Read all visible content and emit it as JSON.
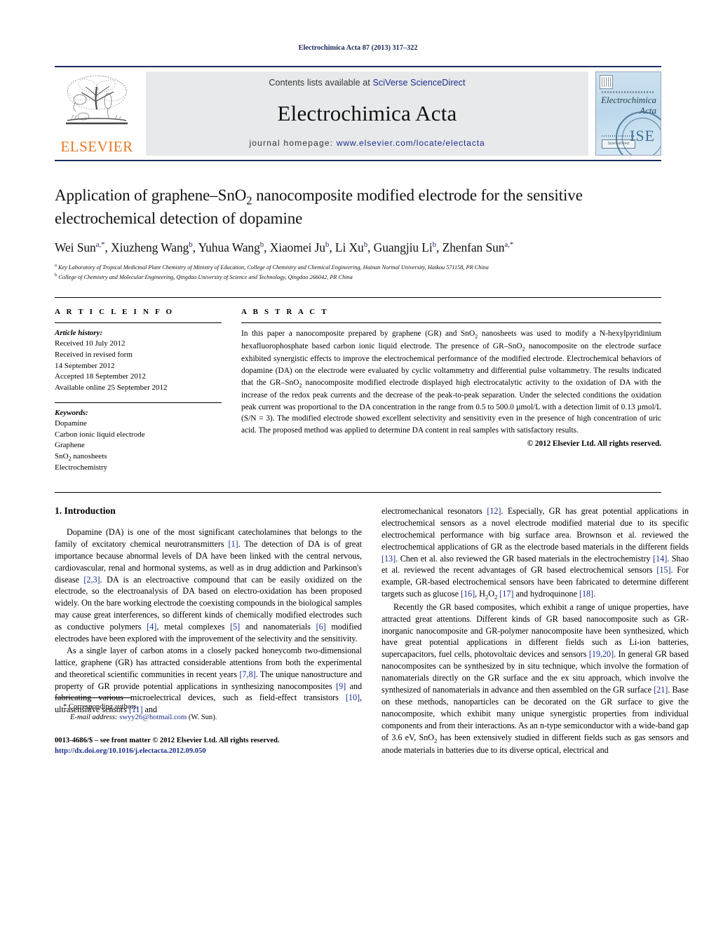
{
  "running_head": "Electrochimica Acta 87 (2013) 317–322",
  "masthead": {
    "publisher_name": "ELSEVIER",
    "contents_prefix": "Contents lists available at ",
    "contents_link": "SciVerse ScienceDirect",
    "journal_title": "Electrochimica Acta",
    "homepage_prefix": "journal homepage: ",
    "homepage_url": "www.elsevier.com/locate/electacta",
    "cover": {
      "line1": "Electrochimica",
      "line2": "Acta",
      "banner": "INTERNATIONAL JOURNAL OF ELECTROCHEMISTRY",
      "badge": "ScienceDirect",
      "seal": "ISE"
    },
    "band_bg": "#e8e9ea",
    "link_color": "#1a2e8c",
    "rule_color": "#1b2a5e",
    "elsevier_orange": "#e87722"
  },
  "article": {
    "title_line1": "Application of graphene–SnO",
    "title_sub1": "2",
    "title_line1b": " nanocomposite modified electrode for the",
    "title_line2": "sensitive electrochemical detection of dopamine",
    "authors_full": "Wei Sun a,*, Xiuzheng Wang b, Yuhua Wang b, Xiaomei Ju b, Li Xu b, Guangjiu Li b, Zhenfan Sun a,*",
    "authors": [
      {
        "name": "Wei Sun",
        "sup": "a,*"
      },
      {
        "name": "Xiuzheng Wang",
        "sup": "b"
      },
      {
        "name": "Yuhua Wang",
        "sup": "b"
      },
      {
        "name": "Xiaomei Ju",
        "sup": "b"
      },
      {
        "name": "Li Xu",
        "sup": "b"
      },
      {
        "name": "Guangjiu Li",
        "sup": "b"
      },
      {
        "name": "Zhenfan Sun",
        "sup": "a,*"
      }
    ],
    "affiliations": [
      {
        "marker": "a",
        "text": "Key Laboratory of Tropical Medicinal Plant Chemistry of Ministry of Education, College of Chemistry and Chemical Engineering, Hainan Normal University, Haikou 571158, PR China"
      },
      {
        "marker": "b",
        "text": "College of Chemistry and Molecular Engineering, Qingdao University of Science and Technology, Qingdao 266042, PR China"
      }
    ]
  },
  "article_info": {
    "heading": "A R T I C L E   I N F O",
    "history_label": "Article history:",
    "history": [
      "Received 10 July 2012",
      "Received in revised form",
      "14 September 2012",
      "Accepted 18 September 2012",
      "Available online 25 September 2012"
    ],
    "keywords_label": "Keywords:",
    "keywords": [
      "Dopamine",
      "Carbon ionic liquid electrode",
      "Graphene",
      "SnO2 nanosheets",
      "Electrochemistry"
    ]
  },
  "abstract": {
    "heading": "A B S T R A C T",
    "paragraph_1": "In this paper a nanocomposite prepared by graphene (GR) and SnO",
    "paragraph_1b": " nanosheets was used to modify a N-hexylpyridinium hexafluorophosphate based carbon ionic liquid electrode. The presence of GR–SnO",
    "paragraph_1c": " nanocomposite on the electrode surface exhibited synergistic effects to improve the electrochemical performance of the modified electrode. Electrochemical behaviors of dopamine (DA) on the electrode were evaluated by cyclic voltammetry and differential pulse voltammetry. The results indicated that the GR–SnO",
    "paragraph_1d": " nanocomposite modified electrode displayed high electrocatalytic activity to the oxidation of DA with the increase of the redox peak currents and the decrease of the peak-to-peak separation. Under the selected conditions the oxidation peak current was proportional to the DA concentration in the range from 0.5 to 500.0 µmol/L with a detection limit of 0.13 µmol/L (S/N = 3). The modified electrode showed excellent selectivity and sensitivity even in the presence of high concentration of uric acid. The proposed method was applied to determine DA content in real samples with satisfactory results.",
    "copyright": "© 2012 Elsevier Ltd. All rights reserved."
  },
  "body": {
    "section_number_title": "1.  Introduction",
    "left_col": {
      "p1_a": "Dopamine (DA) is one of the most significant catecholamines that belongs to the family of excitatory chemical neurotransmitters ",
      "p1_r1": "[1]",
      "p1_b": ". The detection of DA is of great importance because abnormal levels of DA have been linked with the central nervous, cardiovascular, renal and hormonal systems, as well as in drug addiction and Parkinson's disease ",
      "p1_r2": "[2,3]",
      "p1_c": ". DA is an electroactive compound that can be easily oxidized on the electrode, so the electroanalysis of DA based on electro-oxidation has been proposed widely. On the bare working electrode the coexisting compounds in the biological samples may cause great interferences, so different kinds of chemically modified electrodes such as conductive polymers ",
      "p1_r3": "[4]",
      "p1_d": ", metal complexes ",
      "p1_r4": "[5]",
      "p1_e": " and nanomaterials ",
      "p1_r5": "[6]",
      "p1_f": " modified electrodes have been explored with the improvement of the selectivity and the sensitivity.",
      "p2_a": "As a single layer of carbon atoms in a closely packed honeycomb two-dimensional lattice, graphene (GR) has attracted considerable attentions from both the experimental and theoretical scientific communities in recent years ",
      "p2_r1": "[7,8]",
      "p2_b": ". The unique nanostructure and property of GR provide potential applications in synthesizing nanocomposites ",
      "p2_r2": "[9]",
      "p2_c": " and fabricating various microelectrical devices, such as field-effect transistors ",
      "p2_r3": "[10]",
      "p2_d": ", ultrasensitive sensors ",
      "p2_r4": "[11]",
      "p2_e": " and"
    },
    "right_col": {
      "p1_a": "electromechanical resonators ",
      "p1_r1": "[12]",
      "p1_b": ". Especially, GR has great potential applications in electrochemical sensors as a novel electrode modified material due to its specific electrochemical performance with big surface area. Brownson et al. reviewed the electrochemical applications of GR as the electrode based materials in the different fields ",
      "p1_r2": "[13]",
      "p1_c": ". Chen et al. also reviewed the GR based materials in the electrochemistry ",
      "p1_r3": "[14]",
      "p1_d": ". Shao et al. reviewed the recent advantages of GR based electrochemical sensors ",
      "p1_r4": "[15]",
      "p1_e": ". For example, GR-based electrochemical sensors have been fabricated to determine different targets such as glucose ",
      "p1_r5": "[16]",
      "p1_f": ", H",
      "p1_sub1": "2",
      "p1_g": "O",
      "p1_sub2": "2",
      "p1_h": " ",
      "p1_r6": "[17]",
      "p1_i": " and hydroquinone ",
      "p1_r7": "[18]",
      "p1_j": ".",
      "p2_a": "Recently the GR based composites, which exhibit a range of unique properties, have attracted great attentions. Different kinds of GR based nanocomposite such as GR-inorganic nanocomposite and GR-polymer nanocomposite have been synthesized, which have great potential applications in different fields such as Li-ion batteries, supercapacitors, fuel cells, photovoltaic devices and sensors ",
      "p2_r1": "[19,20]",
      "p2_b": ". In general GR based nanocomposites can be synthesized by in situ technique, which involve the formation of nanomaterials directly on the GR surface and the ex situ approach, which involve the synthesized of nanomaterials in advance and then assembled on the GR surface ",
      "p2_r2": "[21]",
      "p2_c": ". Base on these methods, nanoparticles can be decorated on the GR surface to give the nanocomposite, which exhibit many unique synergistic properties from individual components and from their interactions. As an n-type semiconductor with a wide-band gap of 3.6 eV, SnO",
      "p2_sub1": "2",
      "p2_d": " has been extensively studied in different fields such as gas sensors and anode materials in batteries due to its diverse optical, electrical and"
    }
  },
  "footnotes": {
    "corresponding": "* Corresponding authors.",
    "email_label": "E-mail address:",
    "email": "swyy26@hotmail.com",
    "email_suffix": " (W. Sun).",
    "issn_line": "0013-4686/$ – see front matter © 2012 Elsevier Ltd. All rights reserved.",
    "doi": "http://dx.doi.org/10.1016/j.electacta.2012.09.050"
  }
}
